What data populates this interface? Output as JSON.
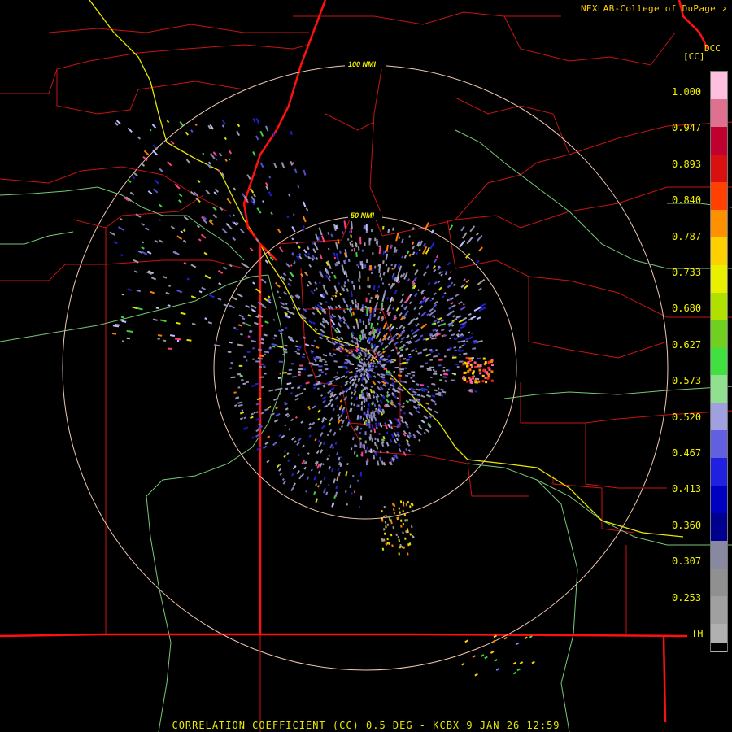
{
  "header": {
    "credit": "NEXLAB-College of DuPage"
  },
  "colorbar": {
    "product_short": "DCC",
    "units": "[CC]",
    "ticks": [
      "1.000",
      "0.947",
      "0.893",
      "0.840",
      "0.787",
      "0.733",
      "0.680",
      "0.627",
      "0.573",
      "0.520",
      "0.467",
      "0.413",
      "0.360",
      "0.307",
      "0.253",
      "TH"
    ],
    "colors": [
      "#ffc0e0",
      "#e07090",
      "#c00030",
      "#d81010",
      "#ff4000",
      "#ff9000",
      "#ffd000",
      "#e8f000",
      "#b0e000",
      "#70d020",
      "#40e040",
      "#90e090",
      "#a0a0e0",
      "#6060e0",
      "#2020e0",
      "#0000c0",
      "#000090",
      "#8888a0",
      "#909090",
      "#a0a0a0",
      "#b0b0b0"
    ]
  },
  "range_rings": [
    {
      "label": "100 NMI",
      "color": "#f0c8b0"
    },
    {
      "label": "50 NMI",
      "color": "#f0c8b0"
    }
  ],
  "footer": {
    "caption": "CORRELATION COEFFICIENT (CC) 0.5 DEG - KCBX 9 JAN 26 12:59"
  }
}
